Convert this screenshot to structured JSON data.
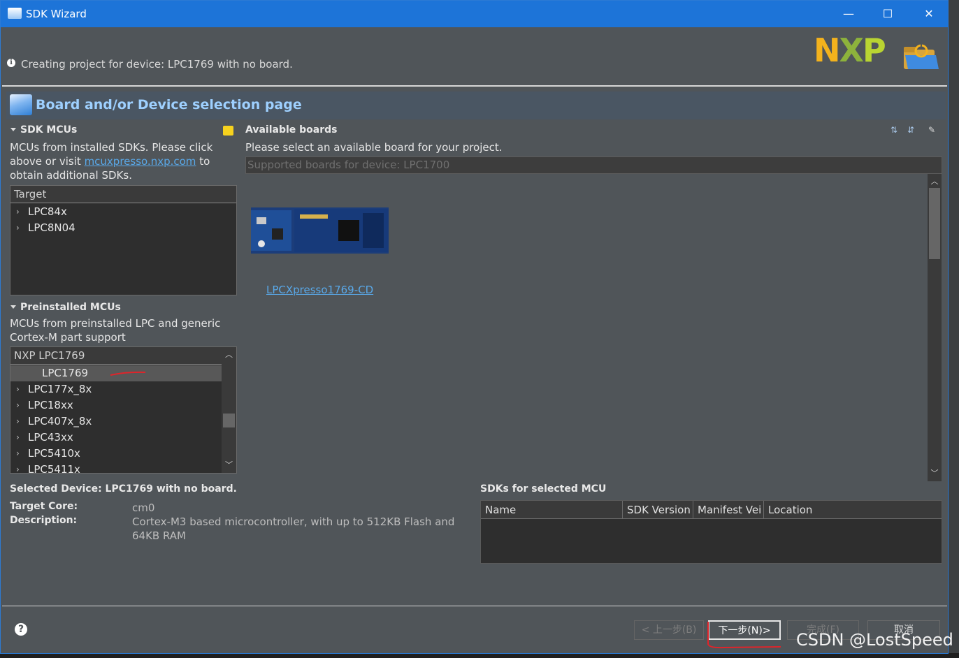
{
  "window": {
    "title": "SDK Wizard",
    "controls": {
      "minimize": "—",
      "maximize": "☐",
      "close": "✕"
    }
  },
  "header": {
    "message": "Creating project for device: LPC1769 with no board.",
    "logo": {
      "n": "N",
      "x": "X",
      "p": "P"
    }
  },
  "page": {
    "title": "Board and/or Device selection page"
  },
  "sdk_mcus": {
    "heading": "SDK MCUs",
    "desc_part1": "MCUs from installed SDKs. Please click above or visit ",
    "link": "mcuxpresso.nxp.com",
    "desc_part2": " to obtain additional SDKs.",
    "filter_value": "Target",
    "items": [
      "LPC84x",
      "LPC8N04"
    ]
  },
  "preinstalled_mcus": {
    "heading": "Preinstalled MCUs",
    "desc": "MCUs from preinstalled LPC and generic Cortex-M part support",
    "filter_value": "NXP LPC1769",
    "selected_item": "LPC1769",
    "items": [
      "LPC177x_8x",
      "LPC18xx",
      "LPC407x_8x",
      "LPC43xx",
      "LPC5410x",
      "LPC5411x"
    ]
  },
  "available_boards": {
    "heading": "Available boards",
    "desc": "Please select an available board for your project.",
    "filter_placeholder": "Supported boards for device: LPC1700",
    "boards": [
      {
        "name": "LPCXpresso1769-CD"
      }
    ]
  },
  "selected_device": {
    "heading": "Selected Device: LPC1769 with no board.",
    "target_core_label": "Target Core:",
    "target_core_value": "cm0",
    "description_label": "Description:",
    "description_value": "Cortex-M3 based microcontroller, with up to 512KB Flash and 64KB RAM"
  },
  "sdks_for_mcu": {
    "heading": "SDKs for selected MCU",
    "columns": [
      "Name",
      "SDK Version",
      "Manifest Vei",
      "Location"
    ],
    "rows": []
  },
  "footer": {
    "help": "?",
    "back": "< 上一步(B)",
    "next": "下一步(N)>",
    "finish": "完成(F)",
    "cancel": "取消"
  },
  "watermark": "CSDN @LostSpeed",
  "colors": {
    "titlebar": "#1d74d8",
    "dialog_bg": "#505559",
    "banner_title": "#9ed0ff",
    "link": "#59a8e8",
    "annotation_red": "#e0242a"
  }
}
